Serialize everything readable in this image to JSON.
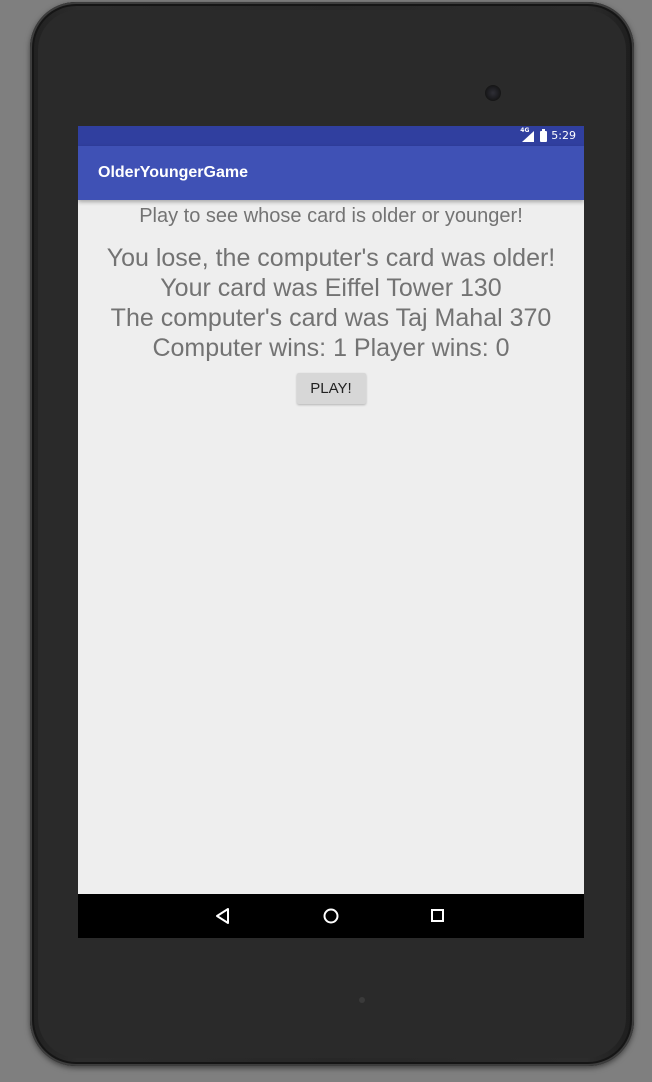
{
  "status_bar": {
    "network_label": "4G",
    "time": "5:29"
  },
  "app_bar": {
    "title": "OlderYoungerGame"
  },
  "main": {
    "instruction": "Play to see whose card is older or younger!",
    "result_lines": [
      "You lose, the computer's card was older!",
      "Your card was Eiffel Tower 130",
      "The computer's card was Taj Mahal 370",
      "Computer wins: 1 Player wins: 0"
    ],
    "play_button_label": "PLAY!"
  },
  "nav_bar": {
    "icons": [
      "back-icon",
      "home-icon",
      "recents-icon"
    ]
  },
  "colors": {
    "status_bar": "#303f9f",
    "app_bar": "#3f51b5",
    "background": "#eeeeee",
    "text": "#737373",
    "button": "#d7d7d7"
  }
}
